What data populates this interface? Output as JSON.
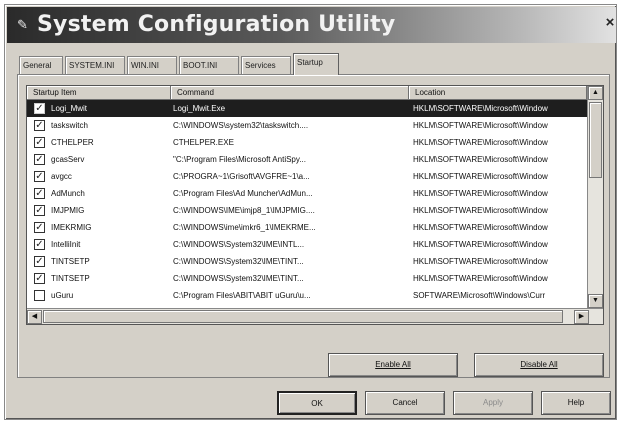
{
  "window": {
    "title": "System Configuration Utility",
    "close_glyph": "×",
    "icon": "msconfig-app-icon"
  },
  "tabs": [
    {
      "label": "General",
      "active": false
    },
    {
      "label": "SYSTEM.INI",
      "active": false
    },
    {
      "label": "WIN.INI",
      "active": false
    },
    {
      "label": "BOOT.INI",
      "active": false
    },
    {
      "label": "Services",
      "active": false
    },
    {
      "label": "Startup",
      "active": true
    }
  ],
  "startup_list": {
    "columns": [
      "Startup Item",
      "Command",
      "Location"
    ],
    "rows": [
      {
        "checked": true,
        "item": "Logi_Mwit",
        "command": "Logi_Mwit.Exe",
        "location": "HKLM\\SOFTWARE\\Microsoft\\Window",
        "selected": true
      },
      {
        "checked": true,
        "item": "taskswitch",
        "command": "C:\\WINDOWS\\system32\\taskswitch....",
        "location": "HKLM\\SOFTWARE\\Microsoft\\Window",
        "selected": false
      },
      {
        "checked": true,
        "item": "CTHELPER",
        "command": "CTHELPER.EXE",
        "location": "HKLM\\SOFTWARE\\Microsoft\\Window",
        "selected": false
      },
      {
        "checked": true,
        "item": "gcasServ",
        "command": "\"C:\\Program Files\\Microsoft AntiSpy...",
        "location": "HKLM\\SOFTWARE\\Microsoft\\Window",
        "selected": false
      },
      {
        "checked": true,
        "item": "avgcc",
        "command": "C:\\PROGRA~1\\Grisoft\\AVGFRE~1\\a...",
        "location": "HKLM\\SOFTWARE\\Microsoft\\Window",
        "selected": false
      },
      {
        "checked": true,
        "item": "AdMunch",
        "command": "C:\\Program Files\\Ad Muncher\\AdMun...",
        "location": "HKLM\\SOFTWARE\\Microsoft\\Window",
        "selected": false
      },
      {
        "checked": true,
        "item": "IMJPMIG",
        "command": "C:\\WINDOWS\\IME\\imjp8_1\\IMJPMIG....",
        "location": "HKLM\\SOFTWARE\\Microsoft\\Window",
        "selected": false
      },
      {
        "checked": true,
        "item": "IMEKRMIG",
        "command": "C:\\WINDOWS\\ime\\imkr6_1\\IMEKRME...",
        "location": "HKLM\\SOFTWARE\\Microsoft\\Window",
        "selected": false
      },
      {
        "checked": true,
        "item": "IntelliInit",
        "command": "C:\\WINDOWS\\System32\\IME\\INTL...",
        "location": "HKLM\\SOFTWARE\\Microsoft\\Window",
        "selected": false
      },
      {
        "checked": true,
        "item": "TINTSETP",
        "command": "C:\\WINDOWS\\System32\\IME\\TINT...",
        "location": "HKLM\\SOFTWARE\\Microsoft\\Window",
        "selected": false
      },
      {
        "checked": true,
        "item": "TINTSETP",
        "command": "C:\\WINDOWS\\System32\\IME\\TINT...",
        "location": "HKLM\\SOFTWARE\\Microsoft\\Window",
        "selected": false
      },
      {
        "checked": false,
        "item": "uGuru",
        "command": "C:\\Program Files\\ABIT\\ABIT uGuru\\u...",
        "location": "SOFTWARE\\Microsoft\\Windows\\Curr",
        "selected": false
      }
    ],
    "scroll_up": "▲",
    "scroll_down": "▼",
    "scroll_left": "◀",
    "scroll_right": "▶",
    "check_glyph": "✓"
  },
  "panel_buttons": {
    "enable_all": "Enable All",
    "disable_all": "Disable All"
  },
  "dialog_buttons": {
    "ok": "OK",
    "cancel": "Cancel",
    "apply": "Apply",
    "help": "Help"
  },
  "colors": {
    "window_face": "#d4d0c8",
    "selection": "#1e1e1e"
  }
}
